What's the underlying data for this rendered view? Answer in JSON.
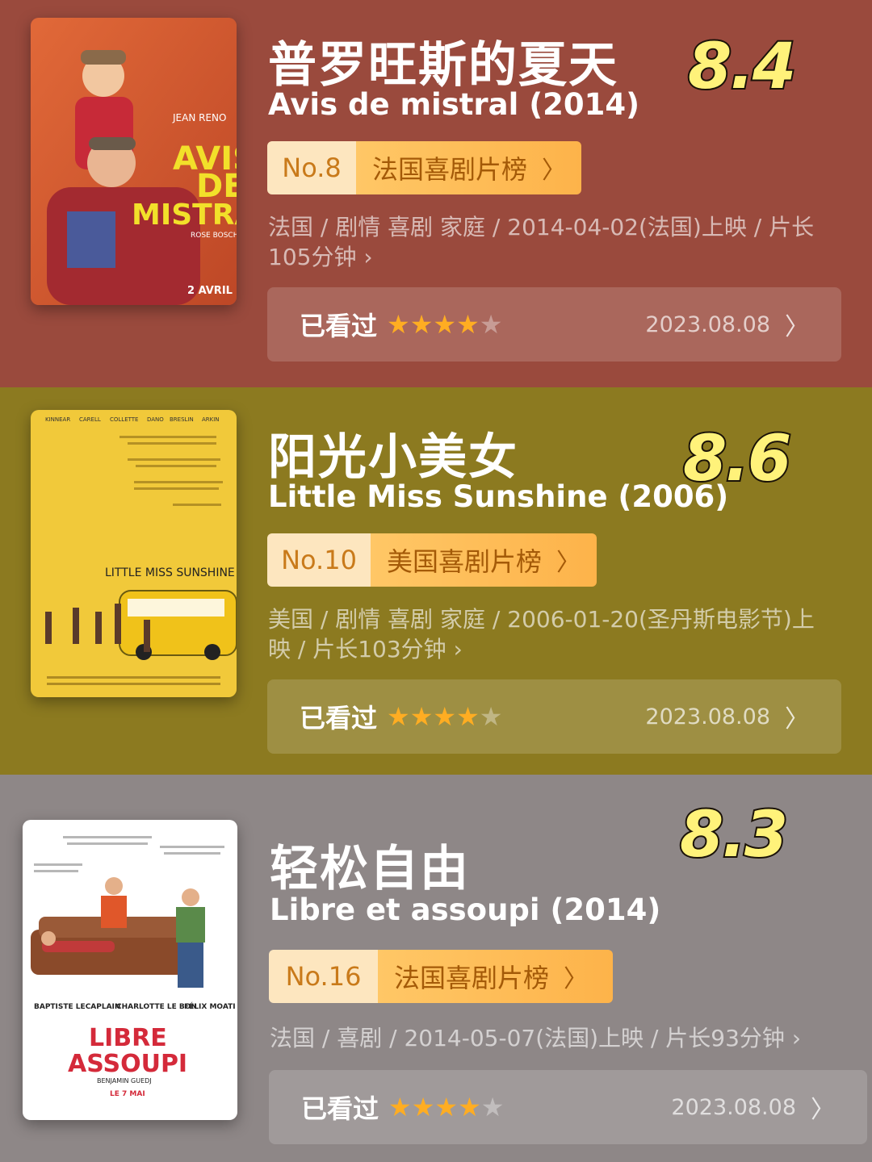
{
  "movies": [
    {
      "title_cn": "普罗旺斯的夏天",
      "title_en": "Avis de mistral (2014)",
      "score": "8.4",
      "rank_no": "No.8",
      "rank_list": "法国喜剧片榜",
      "meta_line1": "法国 / 剧情 喜剧 家庭 / 2014-04-02(法国)上映 / 片长",
      "meta_line2": "105分钟",
      "watched_label": "已看过",
      "rating": 4,
      "watched_date": "2023.08.08",
      "bg_color": "#9a4a3d",
      "poster": {
        "actor": "JEAN RENO",
        "title_lines": [
          "AVIS",
          "DE",
          "MISTRAL"
        ],
        "director": "ROSE BOSCH",
        "date": "2 AVRIL"
      }
    },
    {
      "title_cn": "阳光小美女",
      "title_en": "Little Miss Sunshine (2006)",
      "score": "8.6",
      "rank_no": "No.10",
      "rank_list": "美国喜剧片榜",
      "meta_line1": "美国 / 剧情 喜剧 家庭 / 2006-01-20(圣丹斯电影节)上",
      "meta_line2": "映 / 片长103分钟",
      "watched_label": "已看过",
      "rating": 4,
      "watched_date": "2023.08.08",
      "bg_color": "#8c7a20",
      "poster": {
        "cast": [
          "KINNEAR",
          "CARELL",
          "COLLETTE",
          "DANO",
          "BRESLIN",
          "ARKIN"
        ],
        "title": "LITTLE MISS SUNSHINE"
      }
    },
    {
      "title_cn": "轻松自由",
      "title_en": "Libre et assoupi (2014)",
      "score": "8.3",
      "rank_no": "No.16",
      "rank_list": "法国喜剧片榜",
      "meta_line1": "法国 / 喜剧 / 2014-05-07(法国)上映 / 片长93分钟",
      "meta_line2": "",
      "watched_label": "已看过",
      "rating": 4,
      "watched_date": "2023.08.08",
      "bg_color": "#8e8787",
      "poster": {
        "cast": [
          "BAPTISTE LECAPLAIN",
          "CHARLOTTE LE BON",
          "FÉLIX MOATI"
        ],
        "title_lines": [
          "LIBRE",
          "ASSOUPI"
        ],
        "director": "BENJAMIN GUEDJ",
        "date": "LE 7 MAI"
      }
    }
  ]
}
